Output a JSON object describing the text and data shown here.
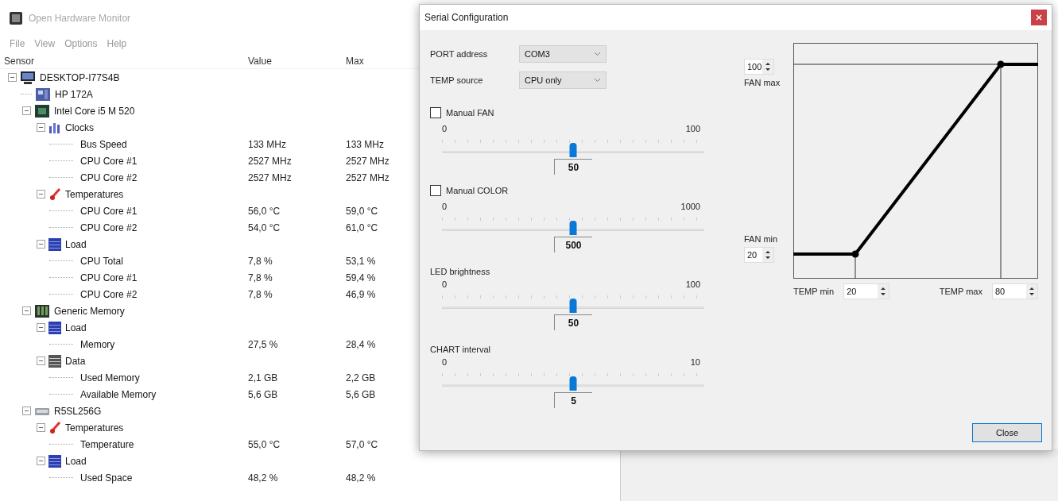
{
  "main_window": {
    "title": "Open Hardware Monitor",
    "menu": [
      "File",
      "View",
      "Options",
      "Help"
    ],
    "columns": [
      "Sensor",
      "Value",
      "Max"
    ],
    "tree": [
      {
        "name": "DESKTOP-I77S4B",
        "kind": "computer",
        "expanded": true,
        "children": [
          {
            "name": "HP 172A",
            "kind": "motherboard"
          },
          {
            "name": "Intel Core i5 M 520",
            "kind": "cpu",
            "expanded": true,
            "children": [
              {
                "name": "Clocks",
                "kind": "clocks",
                "expanded": true,
                "children": [
                  {
                    "name": "Bus Speed",
                    "kind": "sensor",
                    "value": "133 MHz",
                    "max": "133 MHz"
                  },
                  {
                    "name": "CPU Core #1",
                    "kind": "sensor",
                    "value": "2527 MHz",
                    "max": "2527 MHz"
                  },
                  {
                    "name": "CPU Core #2",
                    "kind": "sensor",
                    "value": "2527 MHz",
                    "max": "2527 MHz"
                  }
                ]
              },
              {
                "name": "Temperatures",
                "kind": "temperature",
                "expanded": true,
                "children": [
                  {
                    "name": "CPU Core #1",
                    "kind": "sensor",
                    "value": "56,0 °C",
                    "max": "59,0 °C"
                  },
                  {
                    "name": "CPU Core #2",
                    "kind": "sensor",
                    "value": "54,0 °C",
                    "max": "61,0 °C"
                  }
                ]
              },
              {
                "name": "Load",
                "kind": "load",
                "expanded": true,
                "children": [
                  {
                    "name": "CPU Total",
                    "kind": "sensor",
                    "value": "7,8 %",
                    "max": "53,1 %"
                  },
                  {
                    "name": "CPU Core #1",
                    "kind": "sensor",
                    "value": "7,8 %",
                    "max": "59,4 %"
                  },
                  {
                    "name": "CPU Core #2",
                    "kind": "sensor",
                    "value": "7,8 %",
                    "max": "46,9 %"
                  }
                ]
              }
            ]
          },
          {
            "name": "Generic Memory",
            "kind": "memory",
            "expanded": true,
            "children": [
              {
                "name": "Load",
                "kind": "load",
                "expanded": true,
                "children": [
                  {
                    "name": "Memory",
                    "kind": "sensor",
                    "value": "27,5 %",
                    "max": "28,4 %"
                  }
                ]
              },
              {
                "name": "Data",
                "kind": "data",
                "expanded": true,
                "children": [
                  {
                    "name": "Used Memory",
                    "kind": "sensor",
                    "value": "2,1 GB",
                    "max": "2,2 GB"
                  },
                  {
                    "name": "Available Memory",
                    "kind": "sensor",
                    "value": "5,6 GB",
                    "max": "5,6 GB"
                  }
                ]
              }
            ]
          },
          {
            "name": "R5SL256G",
            "kind": "disk",
            "expanded": true,
            "children": [
              {
                "name": "Temperatures",
                "kind": "temperature",
                "expanded": true,
                "children": [
                  {
                    "name": "Temperature",
                    "kind": "sensor",
                    "value": "55,0 °C",
                    "max": "57,0 °C"
                  }
                ]
              },
              {
                "name": "Load",
                "kind": "load",
                "expanded": true,
                "children": [
                  {
                    "name": "Used Space",
                    "kind": "sensor",
                    "value": "48,2 %",
                    "max": "48,2 %"
                  }
                ]
              }
            ]
          }
        ]
      }
    ]
  },
  "dialog": {
    "title": "Serial Configuration",
    "port_label": "PORT address",
    "port": "COM3",
    "temp_source_label": "TEMP source",
    "temp_source": "CPU only",
    "sliders": [
      {
        "kind": "checkbox",
        "label": "Manual FAN",
        "checked": false,
        "min": "0",
        "max": "100",
        "value": "50",
        "level": 0.5
      },
      {
        "kind": "checkbox",
        "label": "Manual COLOR",
        "checked": false,
        "min": "0",
        "max": "1000",
        "value": "500",
        "level": 0.5
      },
      {
        "kind": "label",
        "label": "LED brightness",
        "min": "0",
        "max": "100",
        "value": "50",
        "level": 0.5
      },
      {
        "kind": "label",
        "label": "CHART interval",
        "min": "0",
        "max": "10",
        "value": "5",
        "level": 0.5
      }
    ],
    "curve": {
      "fan_max": "100",
      "fan_max_label": "FAN max",
      "fan_min_label": "FAN min",
      "fan_min": "20",
      "temp_min_label": "TEMP min",
      "temp_min": "20",
      "temp_max_label": "TEMP max",
      "temp_max": "80"
    },
    "close": "Close"
  }
}
